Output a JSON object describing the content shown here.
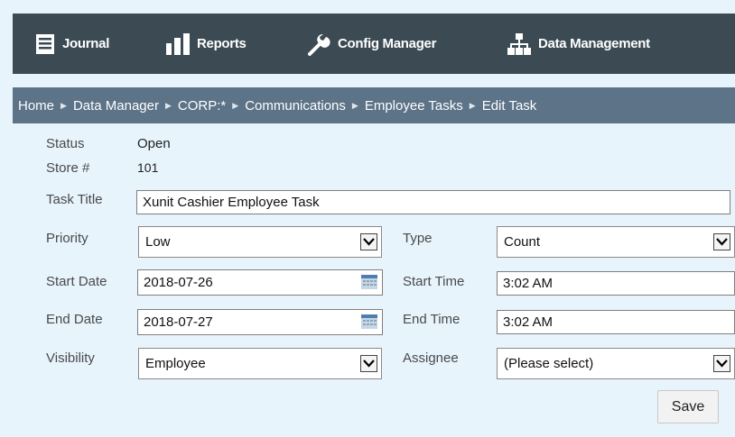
{
  "nav": {
    "items": [
      {
        "label": "Journal",
        "icon": "journal-icon"
      },
      {
        "label": "Reports",
        "icon": "reports-icon"
      },
      {
        "label": "Config Manager",
        "icon": "wrench-icon"
      },
      {
        "label": "Data Management",
        "icon": "hierarchy-icon"
      }
    ]
  },
  "breadcrumb": [
    "Home",
    "Data Manager",
    "CORP:*",
    "Communications",
    "Employee Tasks",
    "Edit Task"
  ],
  "form": {
    "status_label": "Status",
    "status_value": "Open",
    "store_label": "Store #",
    "store_value": "101",
    "title_label": "Task Title",
    "title_value": "Xunit Cashier Employee Task",
    "priority_label": "Priority",
    "priority_value": "Low",
    "type_label": "Type",
    "type_value": "Count",
    "start_date_label": "Start Date",
    "start_date_value": "2018-07-26",
    "start_time_label": "Start Time",
    "start_time_value": "3:02 AM",
    "end_date_label": "End Date",
    "end_date_value": "2018-07-27",
    "end_time_label": "End Time",
    "end_time_value": "3:02 AM",
    "visibility_label": "Visibility",
    "visibility_value": "Employee",
    "assignee_label": "Assignee",
    "assignee_value": "(Please select)",
    "save_label": "Save"
  },
  "colors": {
    "navbar": "#3b4a53",
    "breadcrumb_bar": "#5d7388",
    "background": "#e7f4fc"
  }
}
